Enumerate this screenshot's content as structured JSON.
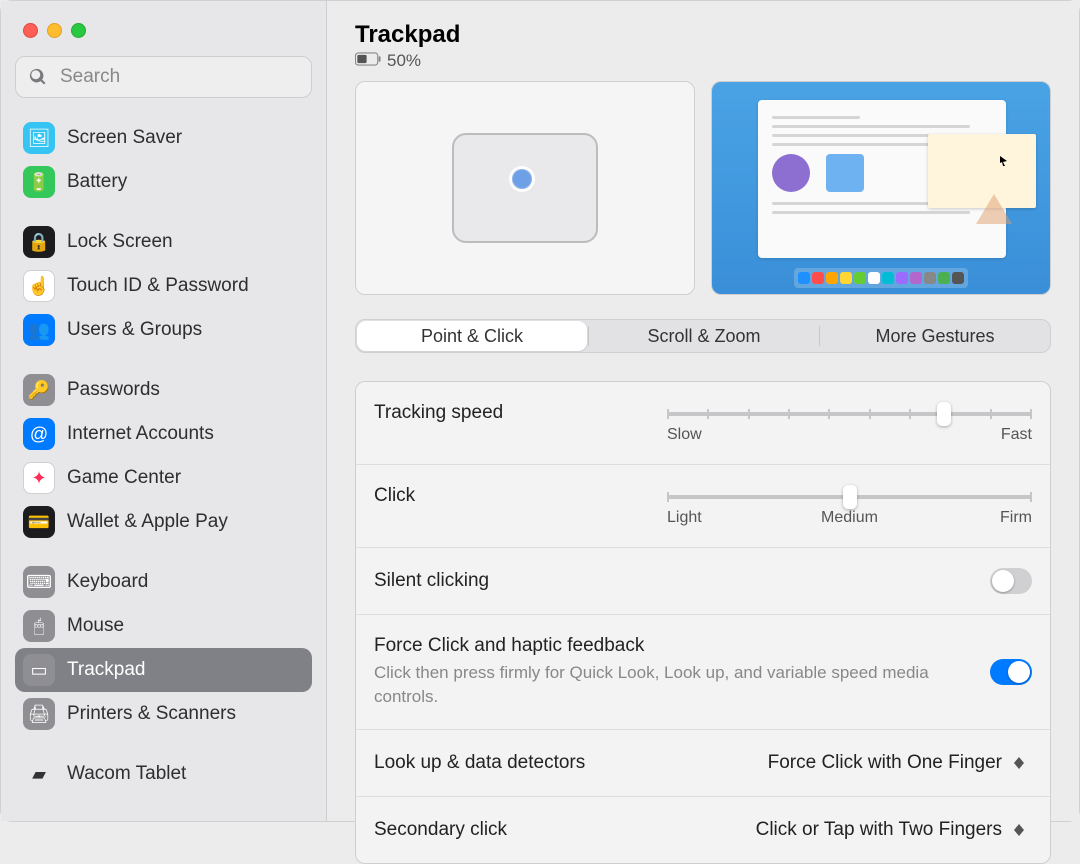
{
  "window": {
    "title": "Trackpad",
    "battery_text": "50%"
  },
  "search": {
    "placeholder": "Search"
  },
  "sidebar": {
    "groups": [
      [
        {
          "label": "Screen Saver",
          "icon_bg": "#36c4f2",
          "glyph": "🖼"
        },
        {
          "label": "Battery",
          "icon_bg": "#34c759",
          "glyph": "🔋"
        }
      ],
      [
        {
          "label": "Lock Screen",
          "icon_bg": "#1c1c1e",
          "glyph": "🔒"
        },
        {
          "label": "Touch ID & Password",
          "icon_bg": "#ffffff",
          "glyph": "☝",
          "glyph_color": "#ff3b30",
          "border": "#d0d0d0"
        },
        {
          "label": "Users & Groups",
          "icon_bg": "#007aff",
          "glyph": "👥"
        }
      ],
      [
        {
          "label": "Passwords",
          "icon_bg": "#8e8e93",
          "glyph": "🔑"
        },
        {
          "label": "Internet Accounts",
          "icon_bg": "#007aff",
          "glyph": "@"
        },
        {
          "label": "Game Center",
          "icon_bg": "#ffffff",
          "glyph": "✦",
          "glyph_color": "#ff2d55",
          "border": "#d0d0d0"
        },
        {
          "label": "Wallet & Apple Pay",
          "icon_bg": "#1c1c1e",
          "glyph": "💳"
        }
      ],
      [
        {
          "label": "Keyboard",
          "icon_bg": "#8e8e93",
          "glyph": "⌨"
        },
        {
          "label": "Mouse",
          "icon_bg": "#8e8e93",
          "glyph": "🖱"
        },
        {
          "label": "Trackpad",
          "icon_bg": "#8e8e93",
          "glyph": "▭",
          "selected": true
        },
        {
          "label": "Printers & Scanners",
          "icon_bg": "#8e8e93",
          "glyph": "🖨"
        }
      ],
      [
        {
          "label": "Wacom Tablet",
          "icon_bg": "transparent",
          "glyph": "▰",
          "glyph_color": "#333"
        }
      ]
    ]
  },
  "tabs": {
    "items": [
      "Point & Click",
      "Scroll & Zoom",
      "More Gestures"
    ],
    "active_index": 0
  },
  "options": {
    "tracking_speed": {
      "label": "Tracking speed",
      "min_label": "Slow",
      "max_label": "Fast",
      "ticks": 10,
      "value_pct": 76
    },
    "click": {
      "label": "Click",
      "labels": [
        "Light",
        "Medium",
        "Firm"
      ],
      "ticks": 3,
      "value_pct": 50
    },
    "silent_clicking": {
      "label": "Silent clicking",
      "on": false
    },
    "force_click": {
      "label": "Force Click and haptic feedback",
      "desc": "Click then press firmly for Quick Look, Look up, and variable speed media controls.",
      "on": true
    },
    "look_up": {
      "label": "Look up & data detectors",
      "value": "Force Click with One Finger"
    },
    "secondary_click": {
      "label": "Secondary click",
      "value": "Click or Tap with Two Fingers"
    }
  },
  "dock_colors": [
    "#1e90ff",
    "#ff4d4d",
    "#ffa500",
    "#ffd633",
    "#66cc33",
    "#ffffff",
    "#00bcd4",
    "#9c6bff",
    "#b366cc",
    "#888888",
    "#4caf50",
    "#555555"
  ]
}
